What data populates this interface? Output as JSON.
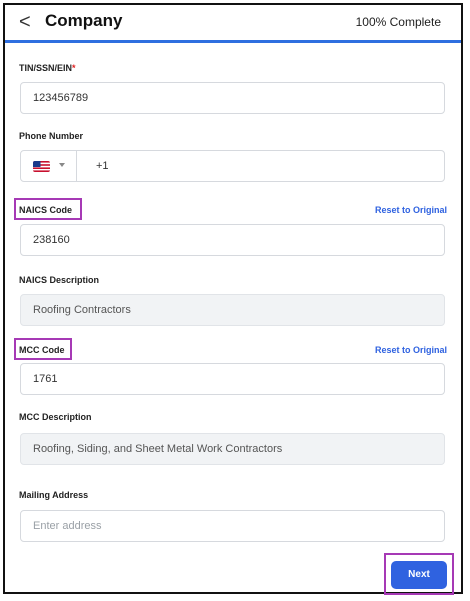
{
  "header": {
    "back_glyph": "<",
    "title": "Company",
    "progress": "100% Complete"
  },
  "tin": {
    "label": "TIN/SSN/EIN",
    "required_mark": "*",
    "value": "123456789"
  },
  "phone": {
    "label": "Phone Number",
    "country": "us-flag-icon",
    "dial_code": "+1"
  },
  "naics": {
    "label": "NAICS Code",
    "reset": "Reset to Original",
    "value": "238160"
  },
  "naics_desc": {
    "label": "NAICS Description",
    "value": "Roofing Contractors"
  },
  "mcc": {
    "label": "MCC Code",
    "reset": "Reset to Original",
    "value": "1761"
  },
  "mcc_desc": {
    "label": "MCC Description",
    "value": "Roofing, Siding, and Sheet Metal Work Contractors"
  },
  "mailing": {
    "label": "Mailing Address",
    "placeholder": "Enter address"
  },
  "actions": {
    "next": "Next"
  },
  "colors": {
    "accent": "#2f62e0",
    "highlight": "#a639b5",
    "required": "#e02020"
  }
}
